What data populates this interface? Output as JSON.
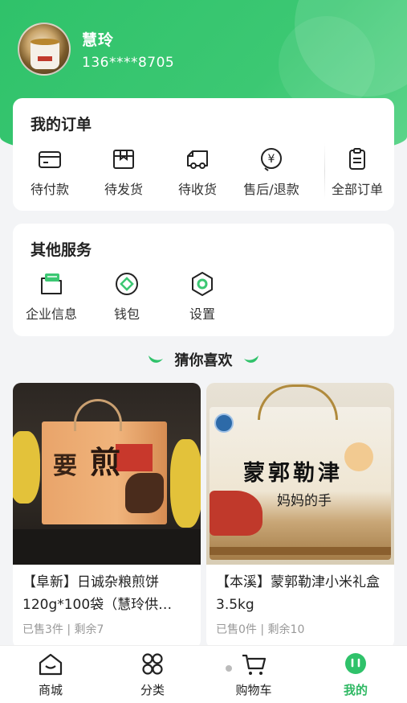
{
  "profile": {
    "name": "慧玲",
    "phone": "136****8705"
  },
  "orders": {
    "title": "我的订单",
    "items": [
      {
        "label": "待付款",
        "icon": "card-icon"
      },
      {
        "label": "待发货",
        "icon": "box-icon"
      },
      {
        "label": "待收货",
        "icon": "truck-icon"
      },
      {
        "label": "售后/退款",
        "icon": "refund-icon"
      },
      {
        "label": "全部订单",
        "icon": "order-list-icon"
      }
    ]
  },
  "services": {
    "title": "其他服务",
    "items": [
      {
        "label": "企业信息",
        "icon": "company-icon"
      },
      {
        "label": "钱包",
        "icon": "wallet-icon"
      },
      {
        "label": "设置",
        "icon": "settings-icon"
      }
    ]
  },
  "recommend": {
    "title": "猜你喜欢"
  },
  "products": [
    {
      "title": "【阜新】日诚杂粮煎饼120g*100袋（慧玲供…",
      "sold": "已售3件",
      "remain": "剩余7",
      "pack_text_1": "要",
      "pack_text_2": "煎"
    },
    {
      "title": "【本溪】蒙郭勒津小米礼盒3.5kg",
      "sold": "已售0件",
      "remain": "剩余10",
      "pack_text_1": "蒙郭勒津",
      "pack_text_2": "妈妈的手"
    }
  ],
  "nav": [
    {
      "label": "商城",
      "icon": "home-icon"
    },
    {
      "label": "分类",
      "icon": "category-icon"
    },
    {
      "label": "购物车",
      "icon": "cart-icon"
    },
    {
      "label": "我的",
      "icon": "profile-icon",
      "active": true
    }
  ],
  "colors": {
    "brand": "#2fc26a",
    "active_nav": "#2fb863"
  }
}
